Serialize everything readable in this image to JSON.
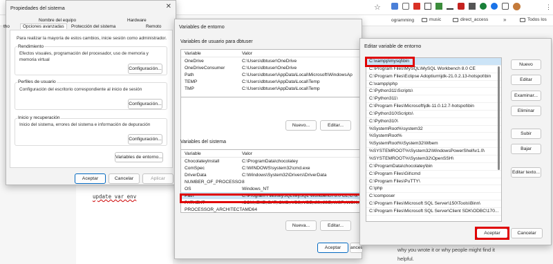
{
  "browser": {
    "bookmarks": [
      {
        "label": "ogramming"
      },
      {
        "label": "music"
      },
      {
        "label": "direct_access"
      },
      {
        "label": "Todos los"
      }
    ],
    "chevron": "»",
    "more": "⋮"
  },
  "sysprops": {
    "title": "Propiedades del sistema",
    "tabs": {
      "t1": "Nombre del equipo",
      "t2": "Hardware",
      "t3": "Opciones avanzadas",
      "t4": "Protección del sistema",
      "t5": "Remoto"
    },
    "clipped_prefix": "tho",
    "admin_note": "Para realizar la mayoría de estos cambios, inicie sesión como administrador.",
    "performance": {
      "label": "Rendimiento",
      "desc": "Efectos visuales, programación del procesador, uso de memoria y memoria virtual",
      "button": "Configuración..."
    },
    "profiles": {
      "label": "Perfiles de usuario",
      "desc": "Configuración del escritorio correspondiente al inicio de sesión",
      "button": "Configuración..."
    },
    "startup": {
      "label": "Inicio y recuperación",
      "desc": "Inicio del sistema, errores del sistema e información de depuración",
      "button": "Configuración..."
    },
    "envbutton": "Variables de entorno...",
    "ok": "Aceptar",
    "cancel": "Cancelar",
    "apply": "Aplicar"
  },
  "envvars": {
    "title": "Variables de entorno",
    "user_label": "Variables de usuario para dbtuser",
    "col_var": "Variable",
    "col_val": "Valor",
    "user_rows": [
      {
        "v": "OneDrive",
        "val": "C:\\Users\\dbtuser\\OneDrive"
      },
      {
        "v": "OneDriveConsumer",
        "val": "C:\\Users\\dbtuser\\OneDrive"
      },
      {
        "v": "Path",
        "val": "C:\\Users\\dbtuser\\AppData\\Local\\Microsoft\\WindowsAp"
      },
      {
        "v": "TEMP",
        "val": "C:\\Users\\dbtuser\\AppData\\Local\\Temp"
      },
      {
        "v": "TMP",
        "val": "C:\\Users\\dbtuser\\AppData\\Local\\Temp"
      }
    ],
    "new1": "Nuevo...",
    "edit1": "Editar...",
    "sys_label": "Variables del sistema",
    "sys_rows": [
      {
        "v": "ChocolateyInstall",
        "val": "C:\\ProgramData\\chocolatey"
      },
      {
        "v": "ComSpec",
        "val": "C:\\WINDOWS\\system32\\cmd.exe"
      },
      {
        "v": "DriverData",
        "val": "C:\\Windows\\System32\\Drivers\\DriverData"
      },
      {
        "v": "NUMBER_OF_PROCESSORS",
        "val": "8"
      },
      {
        "v": "OS",
        "val": "Windows_NT"
      },
      {
        "v": "Path",
        "val": "C:\\Program Files\\MySQL\\MySQL Workbench 8.0 CE;C:\\x"
      },
      {
        "v": "PATHEXT",
        "val": ".COM;.EXE;.BAT;.CMD;.VBS;.VBE;.JS;.JSE;.WSF;.WSH;.MSC;.I"
      },
      {
        "v": "PROCESSOR_ARCHITECTURE",
        "val": "AMD64"
      }
    ],
    "new2": "Nueva...",
    "edit2": "Editar...",
    "ok": "Aceptar",
    "cancel": "Cancelar"
  },
  "editvar": {
    "title": "Editar variable de entorno",
    "items": [
      "C:\\xampp\\mysql\\bin",
      "C:\\Program Files\\MySQL\\MySQL Workbench 8.0 CE",
      "C:\\Program Files\\Eclipse Adoptium\\jdk-21.0.2.13-hotspot\\bin",
      "C:\\xampp\\php",
      "C:\\Python311\\Scripts\\",
      "C:\\Python311\\",
      "C:\\Program Files\\Microsoft\\jdk-11.0.12.7-hotspot\\bin",
      "C:\\Python310\\Scripts\\",
      "C:\\Python310\\",
      "%SystemRoot%\\system32",
      "%SystemRoot%",
      "%SystemRoot%\\System32\\Wbem",
      "%SYSTEMROOT%\\System32\\WindowsPowerShell\\v1.0\\",
      "%SYSTEMROOT%\\System32\\OpenSSH\\",
      "C:\\ProgramData\\chocolatey\\bin",
      "C:\\Program Files\\Git\\cmd",
      "C:\\Program Files\\PuTTY\\",
      "C:\\php",
      "C:\\composer",
      "C:\\Program Files\\Microsoft SQL Server\\150\\Tools\\Binn\\",
      "C:\\Program Files\\Microsoft SQL Server\\Client SDK\\ODBC\\170..."
    ],
    "buttons": {
      "new": "Nuevo",
      "edit": "Editar",
      "browse": "Examinar...",
      "delete": "Eliminar",
      "up": "Subir",
      "down": "Bajar",
      "edittext": "Editar texto..."
    },
    "ok": "Aceptar",
    "cancel": "Cancelar"
  },
  "page": {
    "code": "update var env",
    "bottom1": "why you wrote it or why people might find it",
    "bottom2": "helpful."
  }
}
